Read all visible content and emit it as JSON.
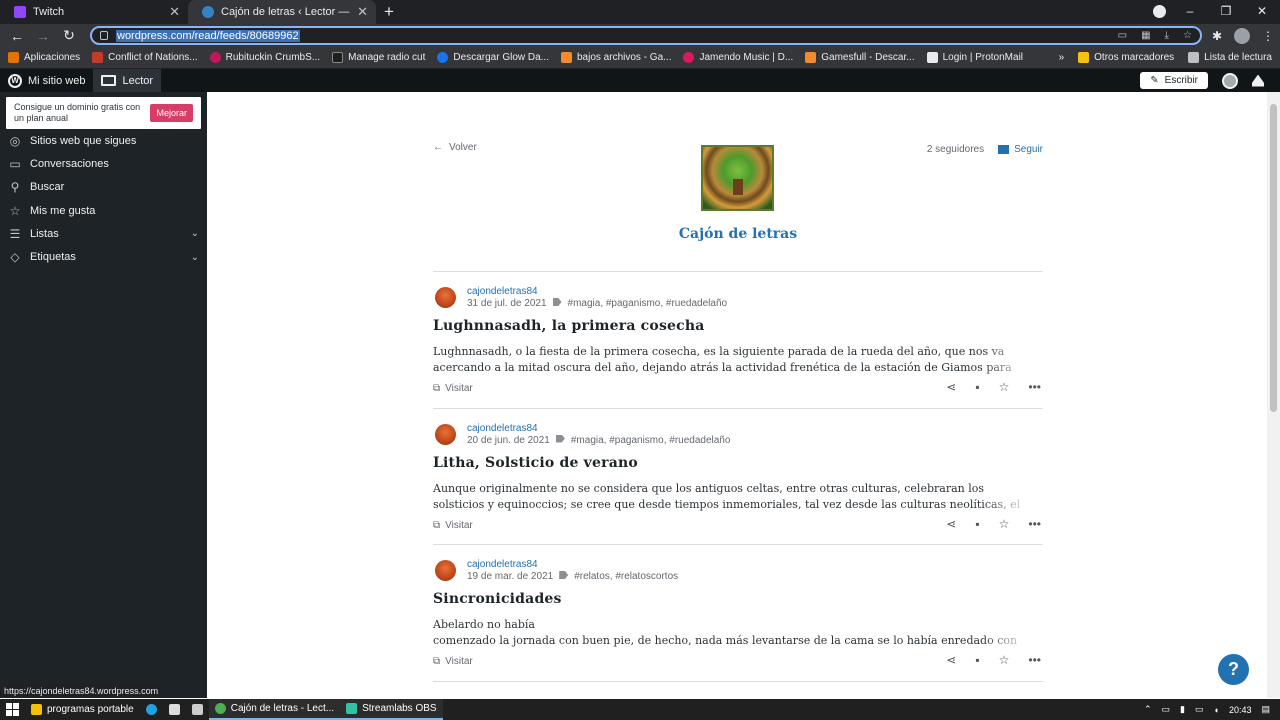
{
  "browser": {
    "tabs": [
      {
        "title": "Twitch",
        "active": false
      },
      {
        "title": "Cajón de letras ‹ Lector — WordPress",
        "active": true
      }
    ],
    "url": "wordpress.com/read/feeds/80689962",
    "bookmarks": [
      "Aplicaciones",
      "Conflict of Nations...",
      "Rubituckin CrumbS...",
      "Manage radio cut",
      "Descargar Glow Da...",
      "bajos archivos - Ga...",
      "Jamendo Music | D...",
      "Gamesfull - Descar...",
      "Login | ProtonMail"
    ],
    "bookmarks_right": [
      "Otros marcadores",
      "Lista de lectura"
    ],
    "status_url": "https://cajondeletras84.wordpress.com"
  },
  "wpbar": {
    "my_site": "Mi sitio web",
    "reader": "Lector",
    "write": "Escribir"
  },
  "sidebar": {
    "promo_text": "Consigue un dominio gratis con un plan anual",
    "promo_button": "Mejorar",
    "items": [
      {
        "label": "Sitios web que sigues",
        "icon": "check-circle-icon"
      },
      {
        "label": "Conversaciones",
        "icon": "chat-icon"
      },
      {
        "label": "Buscar",
        "icon": "search-icon"
      },
      {
        "label": "Mis me gusta",
        "icon": "star-icon"
      },
      {
        "label": "Listas",
        "icon": "list-icon"
      },
      {
        "label": "Etiquetas",
        "icon": "tag-icon"
      }
    ]
  },
  "feed": {
    "back": "Volver",
    "title": "Cajón de letras",
    "followers": "2 seguidores",
    "follow": "Seguir"
  },
  "posts": [
    {
      "author": "cajondeletras84",
      "date": "31 de jul. de 2021",
      "tags": "#magia, #paganismo, #ruedadelaño",
      "title": "Lughnnasadh, la primera cosecha",
      "line1": "Lughnnasadh, o la fiesta de la primera cosecha, es la siguiente parada de la rueda del año, que nos va",
      "line2": "acercando a la mitad oscura del año, dejando atrás la actividad frenética de la estación de Giamos para",
      "visit": "Visitar"
    },
    {
      "author": "cajondeletras84",
      "date": "20 de jun. de 2021",
      "tags": "#magia, #paganismo, #ruedadelaño",
      "title": "Litha, Solsticio de verano",
      "line1": "Aunque originalmente no se considera que los antiguos celtas, entre otras culturas, celebraran los",
      "line2": "solsticios y equinoccios; se cree que desde tiempos inmemoriales, tal vez desde las culturas neolíticas, el",
      "visit": "Visitar"
    },
    {
      "author": "cajondeletras84",
      "date": "19 de mar. de 2021",
      "tags": "#relatos, #relatoscortos",
      "title": "Sincronicidades",
      "line1": "Abelardo no había",
      "line2": "comenzado la jornada con buen pie, de hecho, nada más levantarse de la cama se lo había enredado con",
      "visit": "Visitar"
    }
  ],
  "help": "?",
  "taskbar": {
    "items": [
      "programas portable",
      "Cajón de letras - Lect...",
      "Streamlabs OBS"
    ],
    "time": "20:43"
  }
}
